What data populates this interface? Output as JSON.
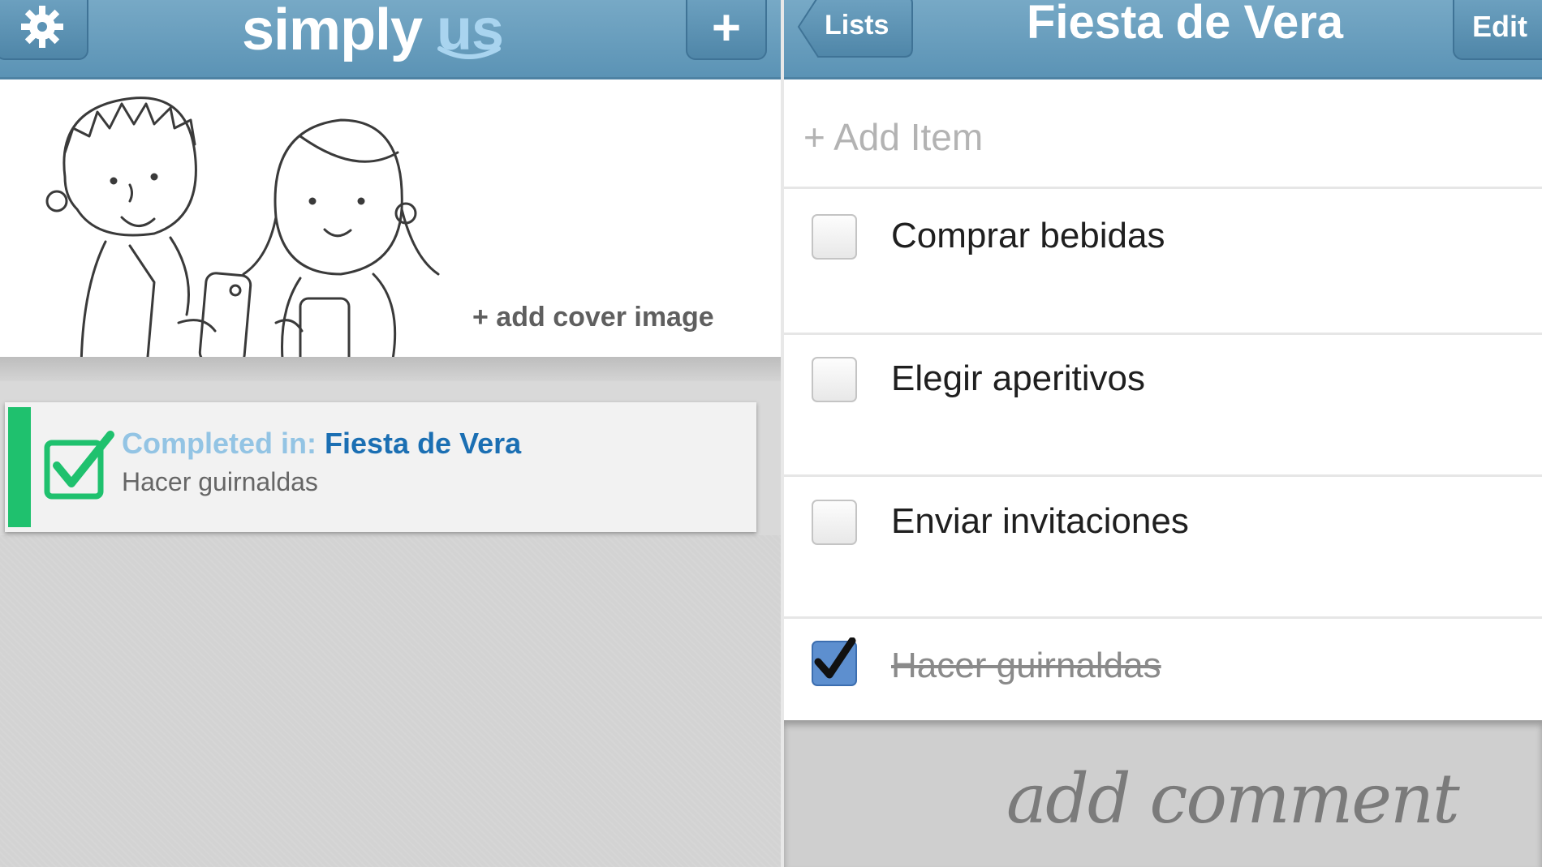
{
  "left": {
    "logo": {
      "part1": "simply",
      "part2": "us"
    },
    "add_list_label": "+",
    "cover": {
      "add_cover_label": "+ add cover image"
    },
    "activity": {
      "prefix": "Completed in:",
      "list_name": "Fiesta de Vera",
      "item": "Hacer guirnaldas"
    }
  },
  "right": {
    "back_label": "Lists",
    "title": "Fiesta de Vera",
    "edit_label": "Edit",
    "add_item_placeholder": "+ Add Item",
    "items": [
      {
        "label": "Comprar bebidas",
        "checked": false
      },
      {
        "label": "Elegir aperitivos",
        "checked": false
      },
      {
        "label": "Enviar invitaciones",
        "checked": false
      },
      {
        "label": "Hacer guirnaldas",
        "checked": true
      }
    ],
    "add_comment": "add comment"
  },
  "colors": {
    "navbar": "#5b93b5",
    "accent_green": "#1fc16e",
    "link_blue": "#1b6fb3",
    "checkbox_checked": "#5d8fcf"
  },
  "icons": [
    "gear-icon",
    "plus-icon",
    "checkmark-icon",
    "back-arrow-icon"
  ]
}
